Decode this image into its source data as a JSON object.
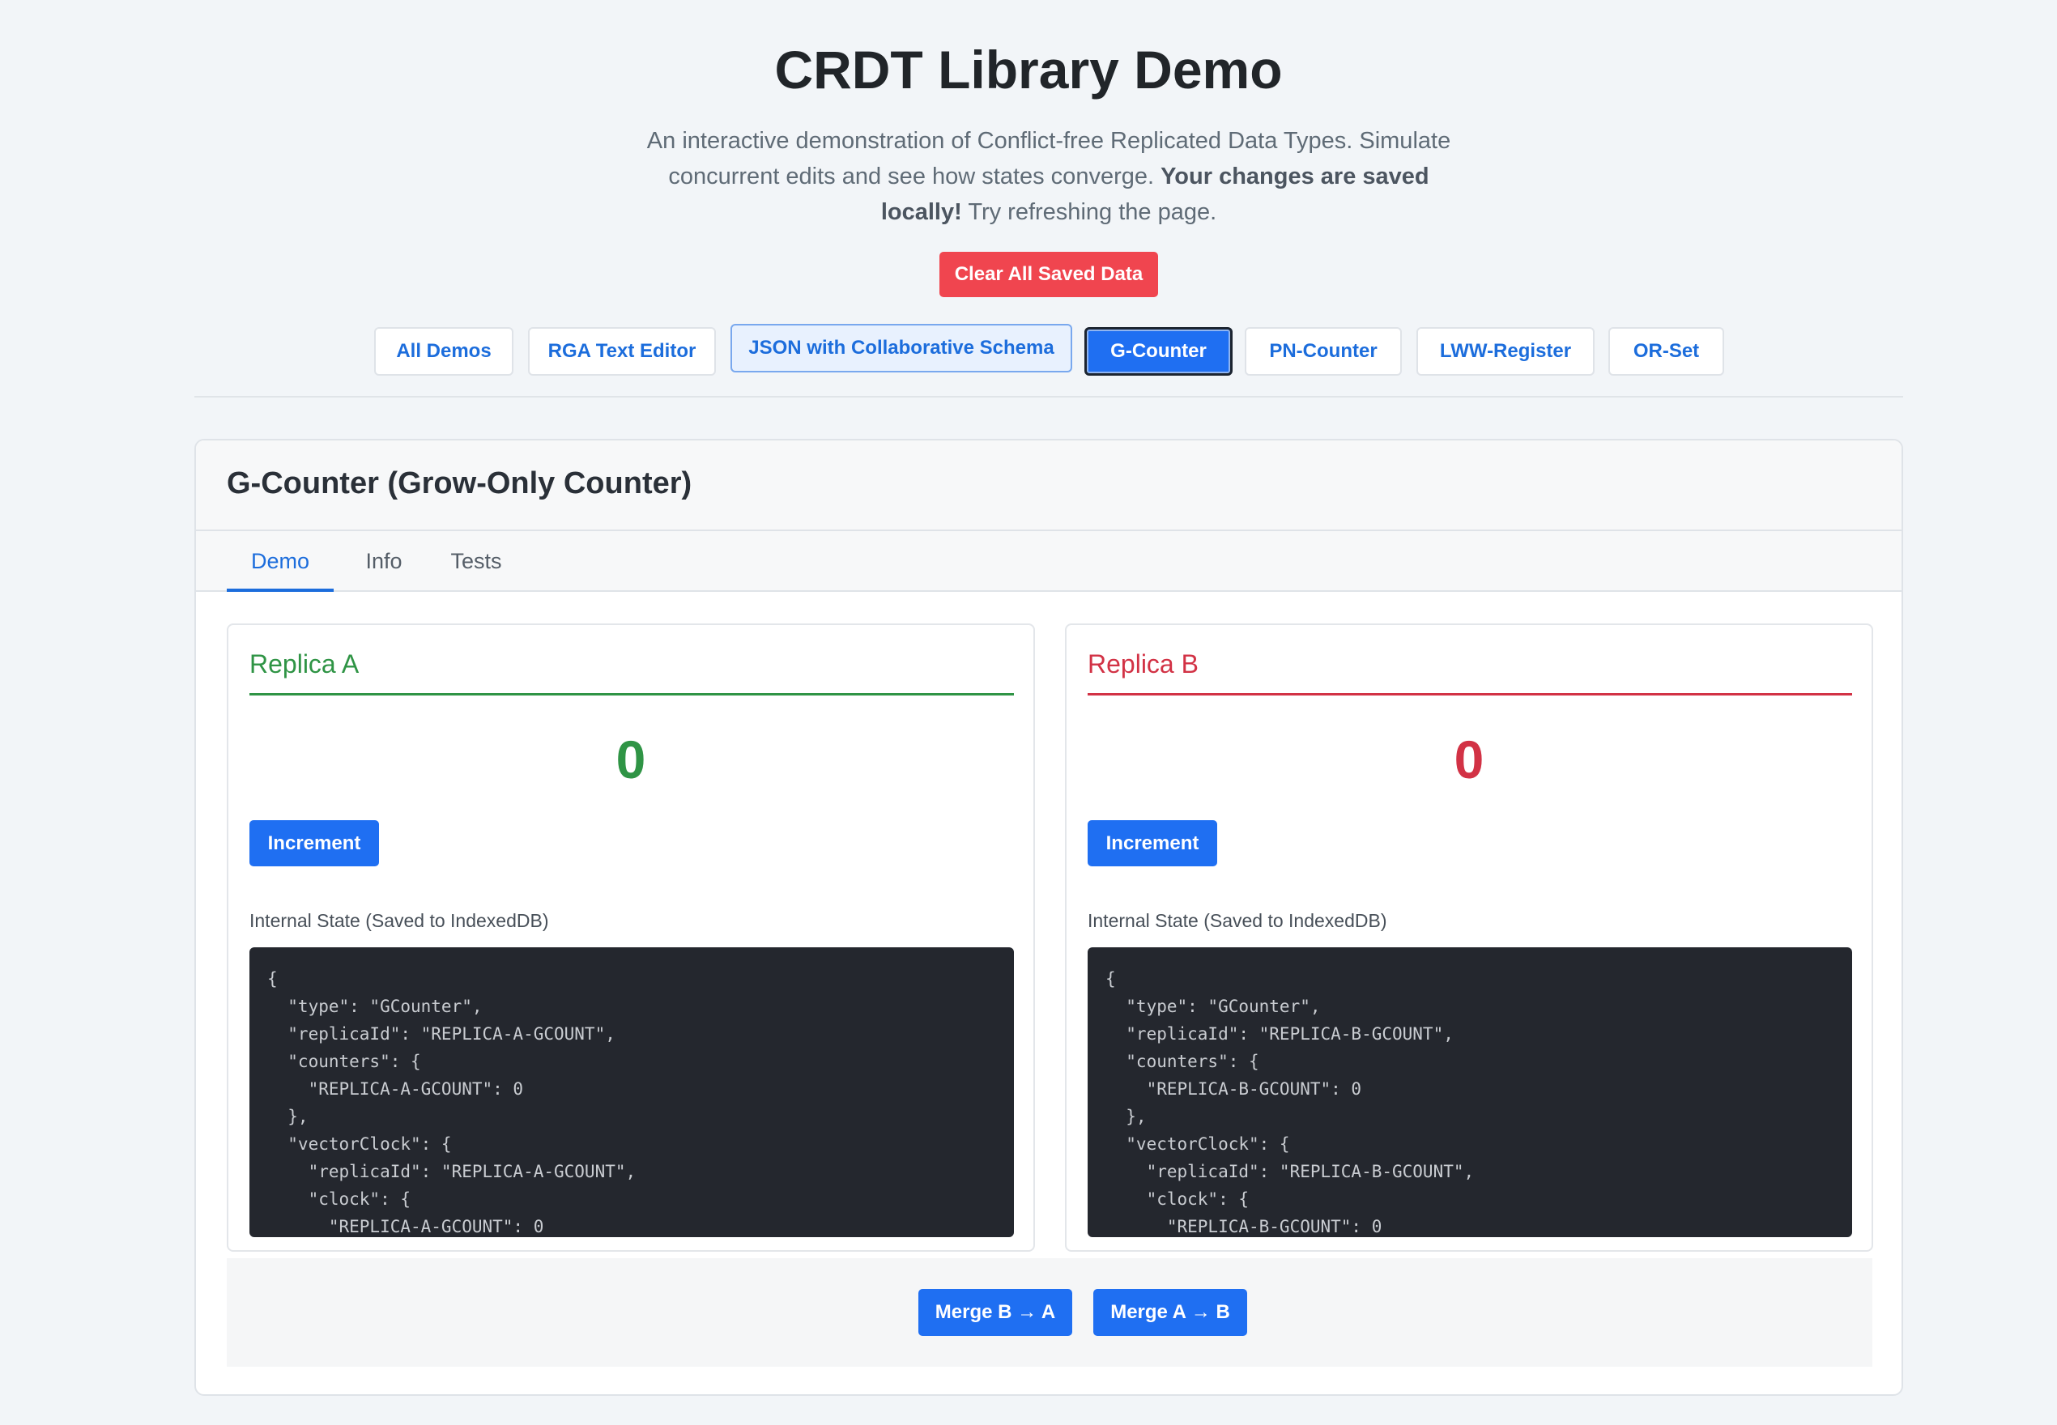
{
  "header": {
    "title": "CRDT Library Demo",
    "intro_text": "An interactive demonstration of Conflict-free Replicated Data Types. Simulate concurrent edits and see how states converge.",
    "intro_bold": "Your changes are saved locally!",
    "intro_tail": "Try refreshing the page.",
    "clear_label": "Clear All Saved Data"
  },
  "nav": {
    "items": [
      {
        "label": "All Demos"
      },
      {
        "label": "RGA Text Editor"
      },
      {
        "label": "JSON with Collaborative Schema"
      },
      {
        "label": "G-Counter"
      },
      {
        "label": "PN-Counter"
      },
      {
        "label": "LWW-Register"
      },
      {
        "label": "OR-Set"
      }
    ],
    "active": "G-Counter"
  },
  "card": {
    "title": "G-Counter (Grow-Only Counter)",
    "tabs": [
      {
        "label": "Demo"
      },
      {
        "label": "Info"
      },
      {
        "label": "Tests"
      }
    ],
    "active_tab": "Demo"
  },
  "replicas": [
    {
      "name": "Replica A",
      "value": "0",
      "color": "#2f9445",
      "increment_label": "Increment",
      "state_label": "Internal State (Saved to IndexedDB)",
      "state_json": "{\n  \"type\": \"GCounter\",\n  \"replicaId\": \"REPLICA-A-GCOUNT\",\n  \"counters\": {\n    \"REPLICA-A-GCOUNT\": 0\n  },\n  \"vectorClock\": {\n    \"replicaId\": \"REPLICA-A-GCOUNT\",\n    \"clock\": {\n      \"REPLICA-A-GCOUNT\": 0"
    },
    {
      "name": "Replica B",
      "value": "0",
      "color": "#d23245",
      "increment_label": "Increment",
      "state_label": "Internal State (Saved to IndexedDB)",
      "state_json": "{\n  \"type\": \"GCounter\",\n  \"replicaId\": \"REPLICA-B-GCOUNT\",\n  \"counters\": {\n    \"REPLICA-B-GCOUNT\": 0\n  },\n  \"vectorClock\": {\n    \"replicaId\": \"REPLICA-B-GCOUNT\",\n    \"clock\": {\n      \"REPLICA-B-GCOUNT\": 0"
    }
  ],
  "merge": {
    "b_to_a_label": "Merge B → A",
    "a_to_b_label": "Merge A → B"
  }
}
